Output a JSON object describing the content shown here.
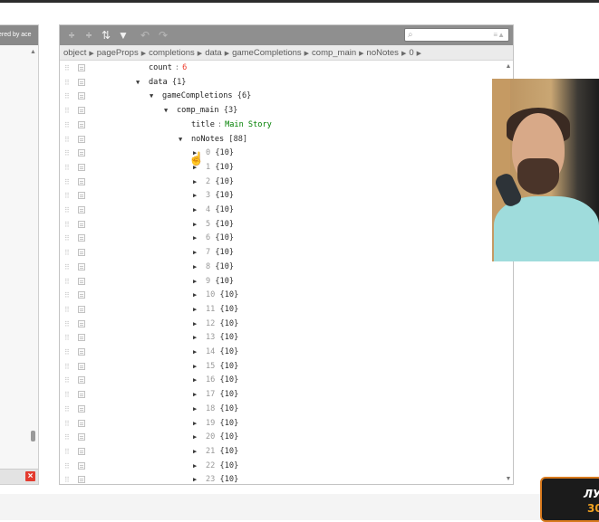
{
  "left_panel": {
    "header_text": "ered by ace"
  },
  "toolbar": {
    "expand_icon": "÷",
    "collapse_icon": "÷",
    "sort_icon": "⇅",
    "filter_icon": "▼",
    "undo_icon": "↶",
    "redo_icon": "↷"
  },
  "search": {
    "value": "",
    "placeholder": ""
  },
  "breadcrumb": [
    "object",
    "pageProps",
    "completions",
    "data",
    "gameCompletions",
    "comp_main",
    "noNotes",
    "0"
  ],
  "tree": {
    "count_key": "count",
    "count_value": "6",
    "data_key": "data",
    "data_count": "{1}",
    "gc_key": "gameCompletions",
    "gc_count": "{6}",
    "cm_key": "comp_main",
    "cm_count": "{3}",
    "title_key": "title",
    "title_value": "Main Story",
    "nn_key": "noNotes",
    "nn_count": "[88]",
    "items": [
      {
        "index": "0",
        "count": "{10}"
      },
      {
        "index": "1",
        "count": "{10}"
      },
      {
        "index": "2",
        "count": "{10}"
      },
      {
        "index": "3",
        "count": "{10}"
      },
      {
        "index": "4",
        "count": "{10}"
      },
      {
        "index": "5",
        "count": "{10}"
      },
      {
        "index": "6",
        "count": "{10}"
      },
      {
        "index": "7",
        "count": "{10}"
      },
      {
        "index": "8",
        "count": "{10}"
      },
      {
        "index": "9",
        "count": "{10}"
      },
      {
        "index": "10",
        "count": "{10}"
      },
      {
        "index": "11",
        "count": "{10}"
      },
      {
        "index": "12",
        "count": "{10}"
      },
      {
        "index": "13",
        "count": "{10}"
      },
      {
        "index": "14",
        "count": "{10}"
      },
      {
        "index": "15",
        "count": "{10}"
      },
      {
        "index": "16",
        "count": "{10}"
      },
      {
        "index": "17",
        "count": "{10}"
      },
      {
        "index": "18",
        "count": "{10}"
      },
      {
        "index": "19",
        "count": "{10}"
      },
      {
        "index": "20",
        "count": "{10}"
      },
      {
        "index": "21",
        "count": "{10}"
      },
      {
        "index": "22",
        "count": "{10}"
      },
      {
        "index": "23",
        "count": "{10}"
      }
    ]
  },
  "logo": {
    "line1": "ЛУ",
    "line2": "30"
  },
  "colors": {
    "toolbar": "#8f8f8f",
    "number": "#ee3a2a",
    "string": "#008000",
    "close": "#e33b2f"
  }
}
